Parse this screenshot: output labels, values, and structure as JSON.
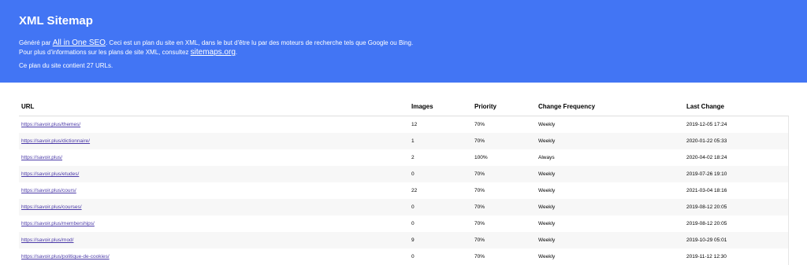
{
  "header": {
    "title": "XML Sitemap",
    "line1_prefix": "Généré par ",
    "aioseo_link": "All in One SEO",
    "line1_suffix": ". Ceci est un plan du site en XML, dans le but d'être lu par des moteurs de recherche tels que Google ou Bing.",
    "line2_prefix": "Pour plus d'informations sur les plans de site XML, consultez ",
    "sitemaps_link": "sitemaps.org",
    "line2_suffix": ".",
    "url_count": "Ce plan du site contient 27 URLs."
  },
  "table": {
    "columns": [
      "URL",
      "Images",
      "Priority",
      "Change Frequency",
      "Last Change"
    ],
    "rows": [
      {
        "url": "https://savoir.plus/themes/",
        "images": "12",
        "priority": "70%",
        "freq": "Weekly",
        "last": "2019-12-05 17:24"
      },
      {
        "url": "https://savoir.plus/dictionnaire/",
        "images": "1",
        "priority": "70%",
        "freq": "Weekly",
        "last": "2020-01-22 05:33"
      },
      {
        "url": "https://savoir.plus/",
        "images": "2",
        "priority": "100%",
        "freq": "Always",
        "last": "2020-04-02 18:24"
      },
      {
        "url": "https://savoir.plus/etudes/",
        "images": "0",
        "priority": "70%",
        "freq": "Weekly",
        "last": "2019-07-26 19:10"
      },
      {
        "url": "https://savoir.plus/cours/",
        "images": "22",
        "priority": "70%",
        "freq": "Weekly",
        "last": "2021-03-04 18:16"
      },
      {
        "url": "https://savoir.plus/courses/",
        "images": "0",
        "priority": "70%",
        "freq": "Weekly",
        "last": "2019-08-12 20:05"
      },
      {
        "url": "https://savoir.plus/memberships/",
        "images": "0",
        "priority": "70%",
        "freq": "Weekly",
        "last": "2019-08-12 20:05"
      },
      {
        "url": "https://savoir.plus/mod/",
        "images": "9",
        "priority": "70%",
        "freq": "Weekly",
        "last": "2019-10-29 05:01"
      },
      {
        "url": "https://savoir.plus/politique-de-cookies/",
        "images": "0",
        "priority": "70%",
        "freq": "Weekly",
        "last": "2019-11-12 12:30"
      }
    ]
  }
}
